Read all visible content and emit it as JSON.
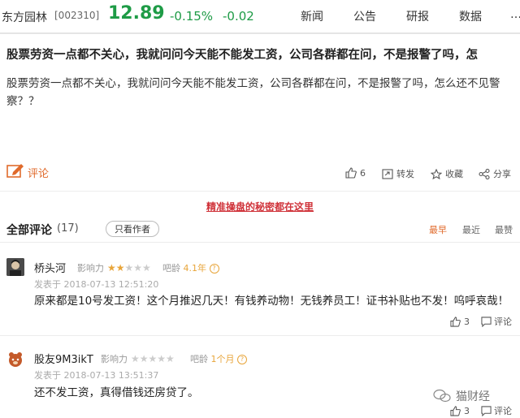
{
  "header": {
    "stock_name": "东方园林",
    "stock_code": "[002310]",
    "price": "12.89",
    "change_pct": "-0.15%",
    "change_abs": "-0.02",
    "nav": [
      "新闻",
      "公告",
      "研报",
      "数据"
    ],
    "price_color": "#1e9b46"
  },
  "post": {
    "title": "股票劳资一点都不关心，我就问问今天能不能发工资，公司各群都在问，不是报警了吗，怎",
    "body": "股票劳资一点都不关心，我就问问今天能不能发工资，公司各群都在问，不是报警了吗，怎么还不见警察？？",
    "comment_label": "评论",
    "likes": "6",
    "repost_label": "转发",
    "favorite_label": "收藏",
    "share_label": "分享"
  },
  "promo": "精准操盘的秘密都在这里",
  "comments_section": {
    "title": "全部评论",
    "count": "(17)",
    "author_only": "只看作者",
    "sort": [
      "最早",
      "最近",
      "最赞"
    ],
    "active_sort": "最早"
  },
  "comments": [
    {
      "name": "桥头河",
      "influence_label": "影响力",
      "influence_stars": 2,
      "bar_age_label": "吧龄",
      "bar_age": "4.1年",
      "time": "发表于 2018-07-13 12:51:20",
      "text": "原来都是10号发工资！这个月推迟几天！有钱养动物！无钱养员工！证书补贴也不发！呜呼哀哉！",
      "likes": "3",
      "reply_label": "评论"
    },
    {
      "name": "股友9M3ikT",
      "influence_label": "影响力",
      "influence_stars": 0,
      "bar_age_label": "吧龄",
      "bar_age": "1个月",
      "time": "发表于 2018-07-13 13:51:37",
      "text": "还不发工资，真得借钱还房贷了。",
      "likes": "3",
      "reply_label": "评论"
    }
  ],
  "watermark": "猫财经",
  "accent_color": "#e06a2b"
}
